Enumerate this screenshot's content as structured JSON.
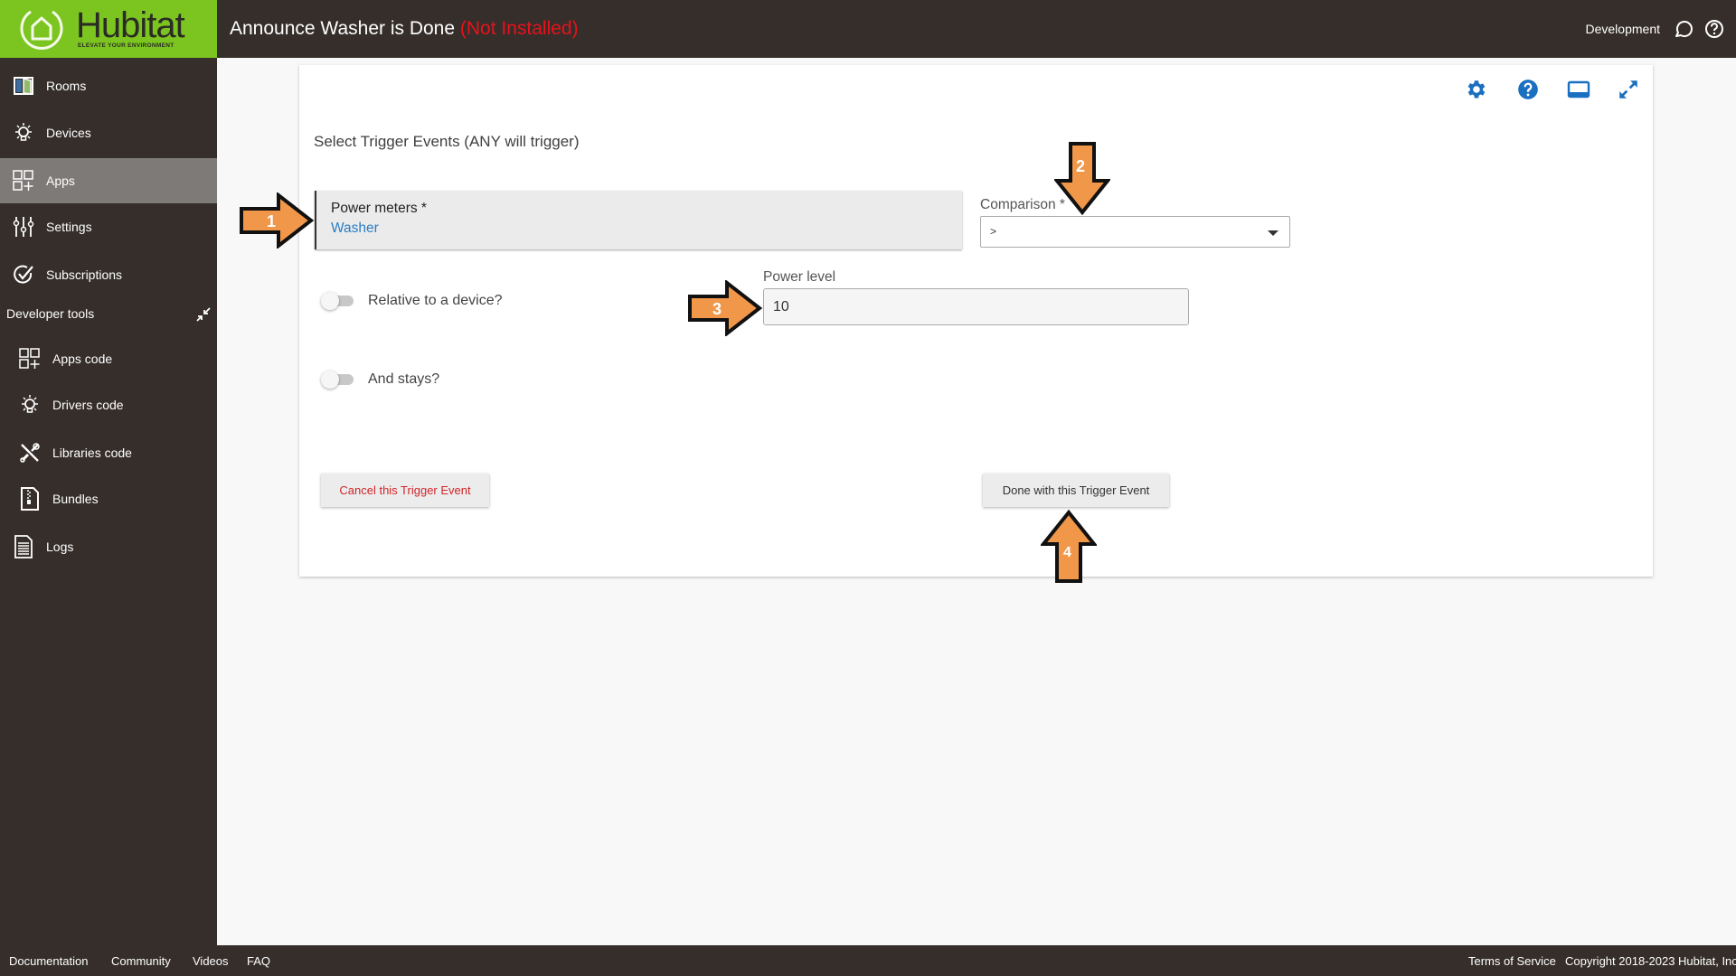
{
  "header": {
    "brand": "Hubitat",
    "tagline": "ELEVATE YOUR ENVIRONMENT",
    "app_title": "Announce Washer is Done",
    "app_status": "(Not Installed)",
    "hub_name": "Development",
    "icons": [
      "chat-icon",
      "help-icon"
    ]
  },
  "sidebar": {
    "items": [
      {
        "label": "Rooms",
        "icon": "rooms-icon",
        "active": false
      },
      {
        "label": "Devices",
        "icon": "bulb-icon",
        "active": false
      },
      {
        "label": "Apps",
        "icon": "apps-grid-icon",
        "active": true
      },
      {
        "label": "Settings",
        "icon": "sliders-icon",
        "active": false
      },
      {
        "label": "Subscriptions",
        "icon": "check-circle-icon",
        "active": false
      }
    ],
    "developer_section": "Developer tools",
    "developer_items": [
      {
        "label": "Apps code",
        "icon": "apps-grid-icon"
      },
      {
        "label": "Drivers code",
        "icon": "bulb-icon"
      },
      {
        "label": "Libraries code",
        "icon": "tools-icon"
      },
      {
        "label": "Bundles",
        "icon": "zip-file-icon"
      },
      {
        "label": "Logs",
        "icon": "document-icon"
      }
    ]
  },
  "card": {
    "icons": [
      "gear-icon",
      "help-icon",
      "display-icon",
      "expand-icon"
    ],
    "section_title": "Select Trigger Events (ANY will trigger)",
    "power_meters": {
      "label": "Power meters *",
      "value": "Washer"
    },
    "comparison": {
      "label": "Comparison *",
      "selected": ">"
    },
    "power_level": {
      "label": "Power level",
      "value": "10"
    },
    "relative_toggle": {
      "label": "Relative to a device?",
      "on": false
    },
    "stays_toggle": {
      "label": "And stays?",
      "on": false
    },
    "cancel_button": "Cancel this Trigger Event",
    "done_button": "Done with this Trigger Event"
  },
  "annotations": [
    {
      "number": "1",
      "direction": "right",
      "points_to": "power-meters"
    },
    {
      "number": "2",
      "direction": "down",
      "points_to": "comparison"
    },
    {
      "number": "3",
      "direction": "right",
      "points_to": "power-level"
    },
    {
      "number": "4",
      "direction": "up",
      "points_to": "done-button"
    }
  ],
  "footer": {
    "links": [
      "Documentation",
      "Community",
      "Videos",
      "FAQ"
    ],
    "terms": "Terms of Service",
    "copyright": "Copyright 2018-2023 Hubitat, Inc."
  },
  "colors": {
    "brand_green": "#7cc520",
    "chrome_dark": "#352e2b",
    "status_red": "#e8121a",
    "link_blue": "#2a7ec4",
    "icon_blue": "#1a6fc0",
    "arrow_orange": "#f0974a"
  }
}
